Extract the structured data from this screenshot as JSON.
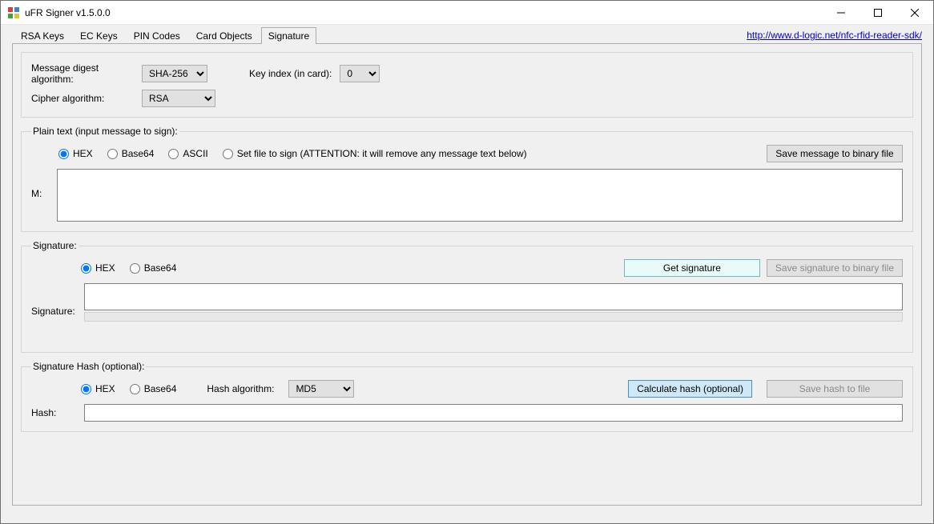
{
  "window": {
    "title": "uFR Signer v1.5.0.0"
  },
  "link": {
    "text": "http://www.d-logic.net/nfc-rfid-reader-sdk/",
    "href": "http://www.d-logic.net/nfc-rfid-reader-sdk/"
  },
  "tabs": {
    "t0": "RSA Keys",
    "t1": "EC Keys",
    "t2": "PIN Codes",
    "t3": "Card Objects",
    "t4": "Signature"
  },
  "algo": {
    "digest_label": "Message digest algorithm:",
    "digest_value": "SHA-256",
    "cipher_label": "Cipher algorithm:",
    "cipher_value": "RSA",
    "keyidx_label": "Key index (in card):",
    "keyidx_value": "0"
  },
  "plain": {
    "legend": "Plain text (input message to sign):",
    "r_hex": "HEX",
    "r_b64": "Base64",
    "r_ascii": "ASCII",
    "r_file": "Set file to sign (ATTENTION: it will remove any message text below)",
    "save_btn": "Save message to binary file",
    "m_label": "M:"
  },
  "sig": {
    "legend": "Signature:",
    "r_hex": "HEX",
    "r_b64": "Base64",
    "get_btn": "Get signature",
    "save_btn": "Save signature to binary file",
    "label": "Signature:"
  },
  "hash": {
    "legend": "Signature Hash (optional):",
    "r_hex": "HEX",
    "r_b64": "Base64",
    "algo_label": "Hash algorithm:",
    "algo_value": "MD5",
    "calc_btn": "Calculate hash (optional)",
    "save_btn": "Save hash to file",
    "label": "Hash:"
  }
}
